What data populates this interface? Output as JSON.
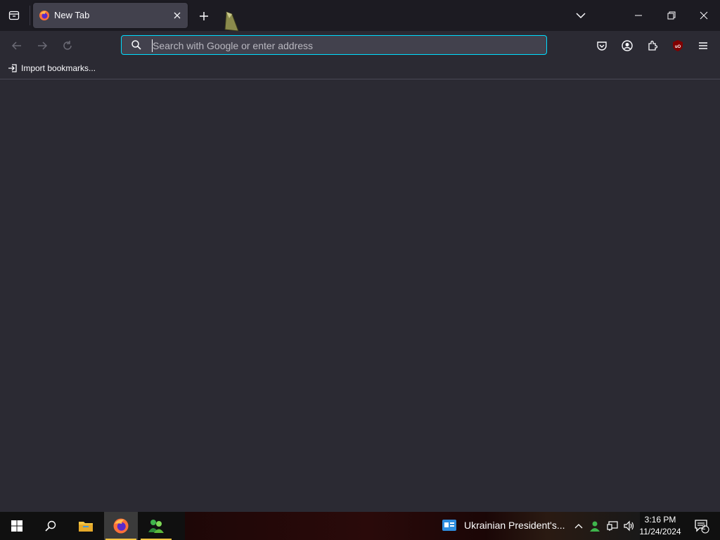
{
  "browser": {
    "tab": {
      "title": "New Tab"
    },
    "urlbar": {
      "placeholder": "Search with Google or enter address"
    },
    "bookmarks": {
      "import_label": "Import bookmarks..."
    },
    "toolbar_icons": [
      "pocket-icon",
      "account-icon",
      "extensions-icon",
      "ublock-icon",
      "menu-icon"
    ]
  },
  "taskbar": {
    "pinned": [
      "start-icon",
      "search-icon",
      "file-explorer-icon",
      "firefox-icon",
      "app-icon"
    ],
    "news": "Ukrainian President's...",
    "clock": {
      "time": "3:16 PM",
      "date": "11/24/2024"
    },
    "notifications": "2"
  },
  "colors": {
    "accent": "#00ddff",
    "chrome": "#1c1b22",
    "content": "#2b2a33",
    "tab": "#42414d"
  }
}
